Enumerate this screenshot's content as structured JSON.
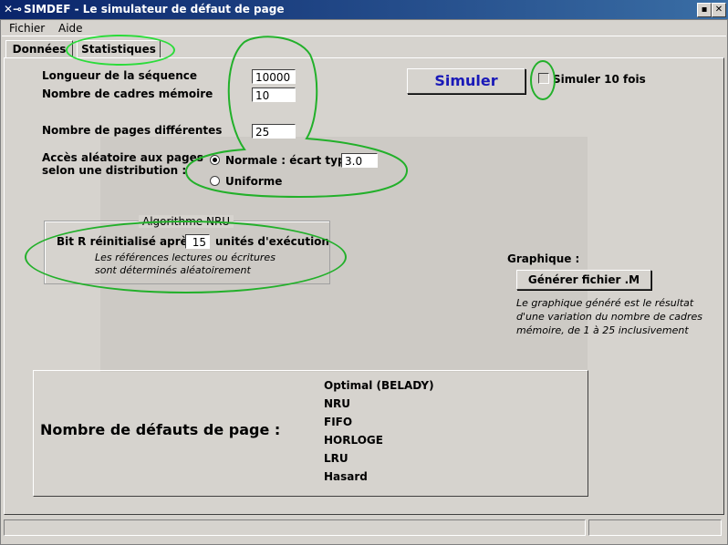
{
  "window": {
    "title": "SIMDEF - Le simulateur de défaut de page",
    "app_icon": "x-window-icon"
  },
  "menu": {
    "items": [
      "Fichier",
      "Aide"
    ]
  },
  "tabs": [
    {
      "label": "Données"
    },
    {
      "label": "Statistiques",
      "active": true
    }
  ],
  "form": {
    "sequence_length_label": "Longueur de la séquence",
    "sequence_length_value": "10000",
    "frames_label": "Nombre de cadres mémoire",
    "frames_value": "10",
    "pages_label": "Nombre de pages différentes",
    "pages_value": "25",
    "access_label_1": "Accès aléatoire aux pages",
    "access_label_2": "selon une distribution :",
    "radio_normal_label": "Normale : écart type",
    "radio_normal_value": "3.0",
    "radio_uniform_label": "Uniforme",
    "selected_distribution": "Normale"
  },
  "simulate": {
    "button_label": "Simuler",
    "checkbox_label": "Simuler 10 fois",
    "checked": false
  },
  "nru": {
    "group_title": "Algorithme NRU",
    "reset_label_before": "Bit R réinitialisé après",
    "reset_value": "15",
    "reset_label_after": "unités d'exécution",
    "note_1": "Les références lectures ou écritures",
    "note_2": "sont déterminés aléatoirement"
  },
  "graph": {
    "heading": "Graphique :",
    "button_label": "Générer fichier .M",
    "note_1": "Le graphique généré est le résultat",
    "note_2": "d'une variation du nombre de cadres",
    "note_3": "mémoire, de 1 à 25 inclusivement"
  },
  "results": {
    "title": "Nombre de défauts de page :",
    "algorithms": [
      "Optimal (BELADY)",
      "NRU",
      "FIFO",
      "HORLOGE",
      "LRU",
      "Hasard"
    ]
  },
  "colors": {
    "accent": "#1a1ab8",
    "annotation": "#22b02a",
    "titlebar": "#0a246a"
  }
}
